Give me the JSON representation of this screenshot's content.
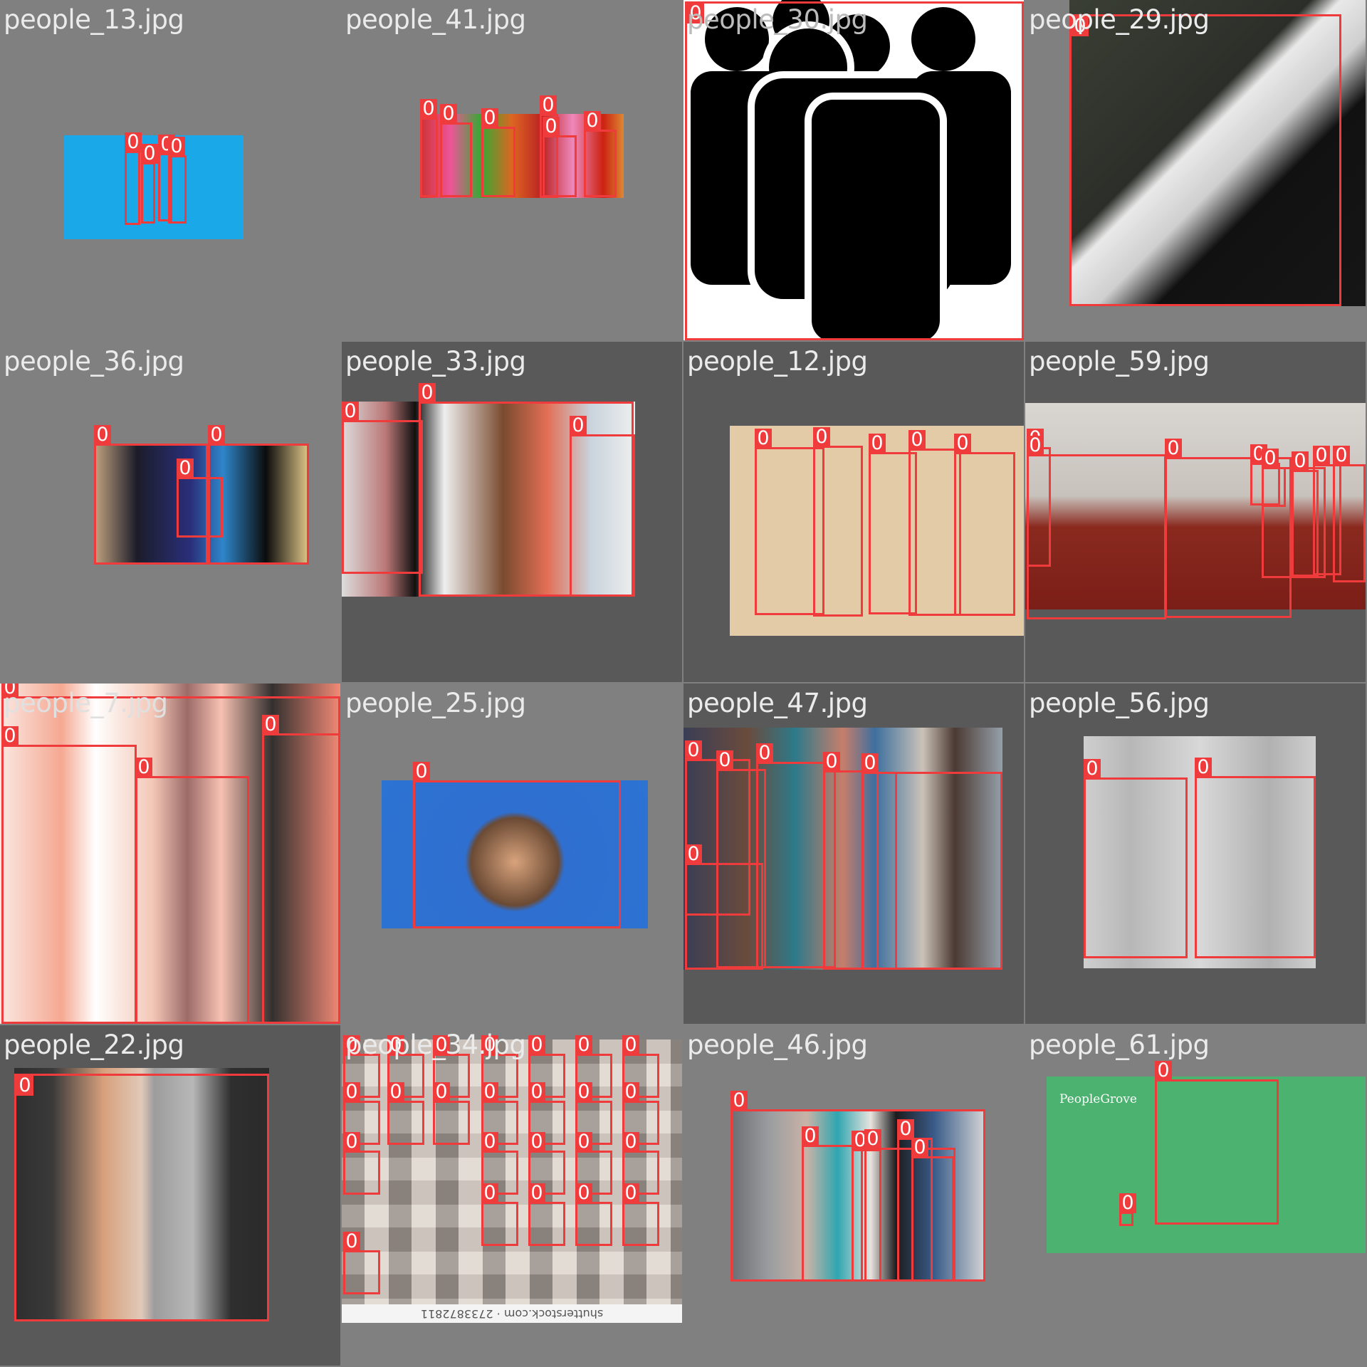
{
  "tiles": [
    {
      "title": "people_13.jpg",
      "label": "0"
    },
    {
      "title": "people_41.jpg",
      "label": "0"
    },
    {
      "title": "people_30.jpg",
      "label": "0"
    },
    {
      "title": "people_29.jpg",
      "label": "0"
    },
    {
      "title": "people_36.jpg",
      "label": "0"
    },
    {
      "title": "people_33.jpg",
      "label": "0"
    },
    {
      "title": "people_12.jpg",
      "label": "0"
    },
    {
      "title": "people_59.jpg",
      "label": "0"
    },
    {
      "title": "people_7.jpg",
      "label": "0"
    },
    {
      "title": "people_25.jpg",
      "label": "0"
    },
    {
      "title": "people_47.jpg",
      "label": "0"
    },
    {
      "title": "people_56.jpg",
      "label": "0"
    },
    {
      "title": "people_22.jpg",
      "label": "0"
    },
    {
      "title": "people_34.jpg",
      "label": "0",
      "watermark": "shutterstock.com · 2733872811"
    },
    {
      "title": "people_46.jpg",
      "label": "0"
    },
    {
      "title": "people_61.jpg",
      "label": "0",
      "logo": "PeopleGrove"
    }
  ]
}
